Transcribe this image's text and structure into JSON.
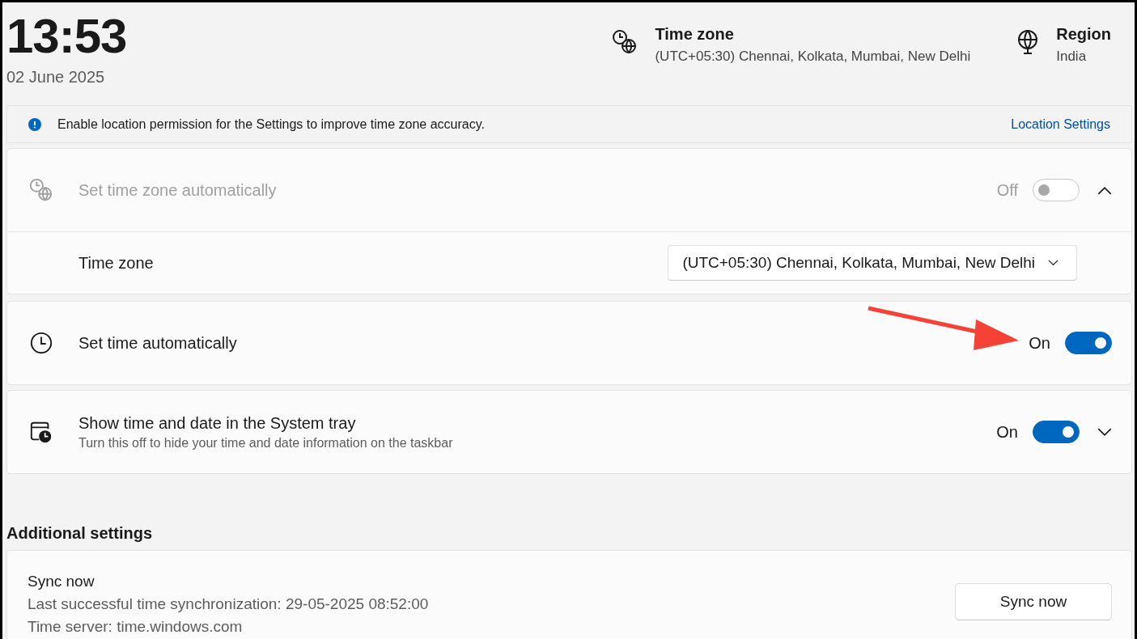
{
  "header": {
    "time": "13:53",
    "date": "02 June 2025",
    "time_zone": {
      "label": "Time zone",
      "value": "(UTC+05:30) Chennai, Kolkata, Mumbai, New Delhi"
    },
    "region": {
      "label": "Region",
      "value": "India"
    }
  },
  "notice": {
    "text": "Enable location permission for the Settings to improve time zone accuracy.",
    "link": "Location Settings"
  },
  "auto_time_zone": {
    "label": "Set time zone automatically",
    "disabled": true,
    "toggle_text": "Off",
    "on": false,
    "expanded": true,
    "time_zone": {
      "label": "Time zone",
      "value": "(UTC+05:30) Chennai, Kolkata, Mumbai, New Delhi"
    }
  },
  "set_time": {
    "label": "Set time automatically",
    "toggle_text": "On",
    "on": true
  },
  "tray": {
    "label": "Show time and date in the System tray",
    "description": "Turn this off to hide your time and date information on the taskbar",
    "toggle_text": "On",
    "on": true,
    "expanded": false
  },
  "additional": {
    "heading": "Additional settings",
    "sync": {
      "title": "Sync now",
      "lines": [
        "Last successful time synchronization: 29-05-2025 08:52:00",
        "Time server: time.windows.com"
      ],
      "button": "Sync now"
    }
  }
}
